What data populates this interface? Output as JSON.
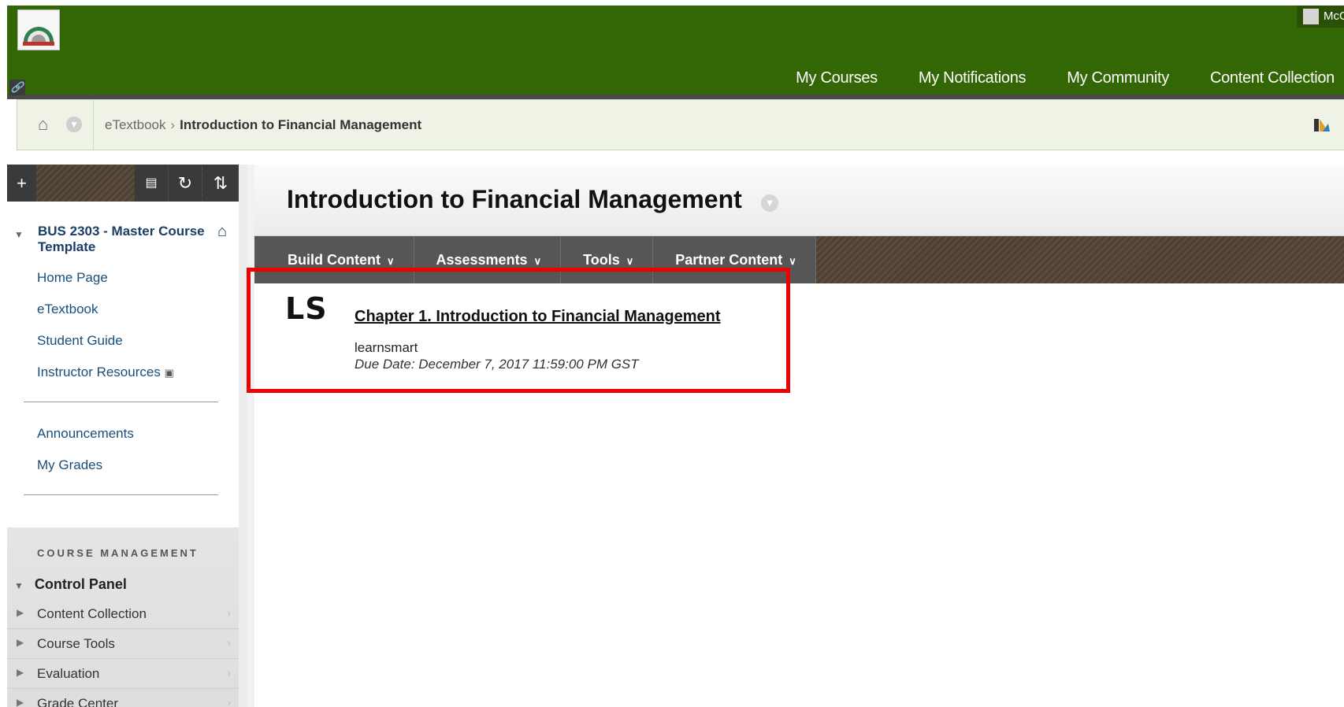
{
  "header": {
    "user_name": "McG",
    "nav": [
      "My Courses",
      "My Notifications",
      "My Community",
      "Content Collection"
    ],
    "background": "#336605"
  },
  "breadcrumb": {
    "parent": "eTextbook",
    "current": "Introduction to Financial Management"
  },
  "sidebar": {
    "toolbar": {
      "add": "+",
      "rotate": "↻",
      "sort": "⇅"
    },
    "course_title": "BUS 2303 - Master Course Template",
    "links": [
      "Home Page",
      "eTextbook",
      "Student Guide",
      "Instructor Resources"
    ],
    "links2": [
      "Announcements",
      "My Grades"
    ],
    "course_management": "COURSE MANAGEMENT",
    "control_panel": "Control Panel",
    "cm_items": [
      "Content Collection",
      "Course Tools",
      "Evaluation",
      "Grade Center"
    ]
  },
  "page": {
    "title": "Introduction to Financial Management",
    "actions": [
      "Build Content",
      "Assessments",
      "Tools",
      "Partner Content"
    ]
  },
  "item": {
    "icon_text": "LS",
    "title": "Chapter 1. Introduction to Financial Management",
    "type": "learnsmart",
    "due": "Due Date: December 7, 2017 11:59:00 PM GST",
    "highlight_color": "#ee0000"
  }
}
